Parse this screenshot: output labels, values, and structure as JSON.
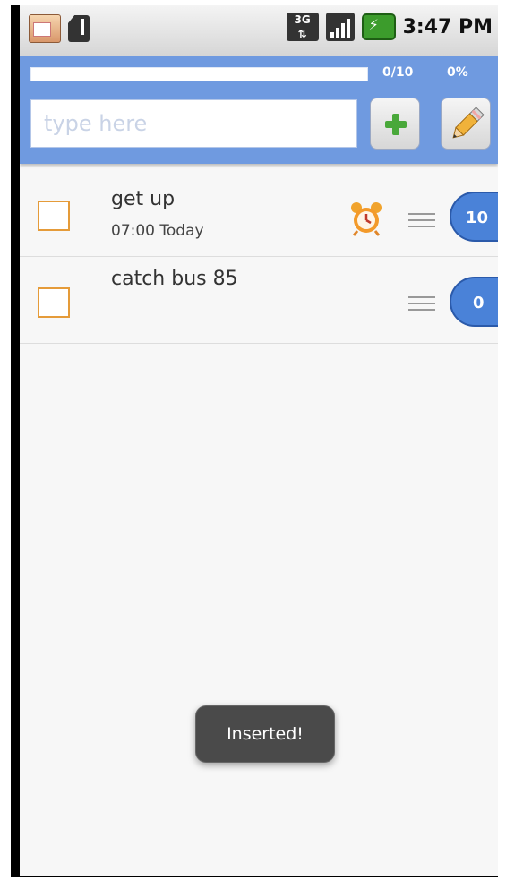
{
  "status_bar": {
    "network": "3G",
    "time": "3:47 PM",
    "icons": [
      "calendar-icon",
      "sd-card-alert-icon",
      "3g-icon",
      "signal-icon",
      "battery-charging-icon"
    ]
  },
  "header": {
    "progress_count": "0/10",
    "progress_percent": "0%",
    "progress_value": 0,
    "input_value": "",
    "input_placeholder": "type here",
    "add_icon": "plus-icon",
    "edit_icon": "pencil-icon"
  },
  "tasks": [
    {
      "title": "get up",
      "subtitle": "07:00  Today",
      "has_alarm": true,
      "priority": "10"
    },
    {
      "title": "catch bus 85",
      "subtitle": "",
      "has_alarm": false,
      "priority": "0"
    }
  ],
  "toast": {
    "message": "Inserted!"
  },
  "colors": {
    "header": "#6f9ae0",
    "badge": "#4a82d8",
    "checkbox": "#e59b39",
    "toast": "#4a4a4a"
  }
}
